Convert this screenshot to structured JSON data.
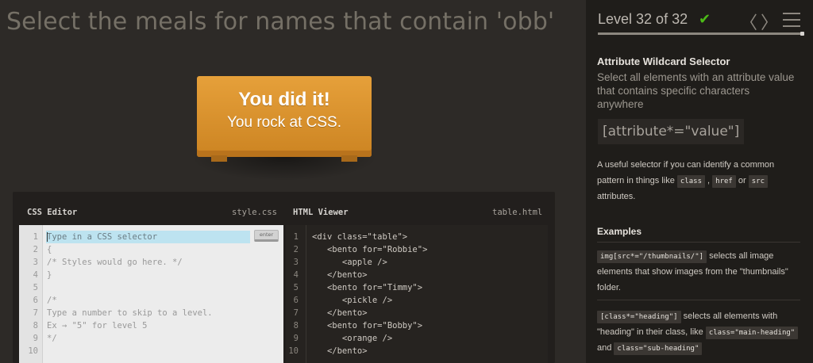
{
  "instruction": "Select the meals for names that contain 'obb'",
  "table": {
    "headline": "You did it!",
    "subline": "You rock at CSS."
  },
  "editor": {
    "css_title": "CSS Editor",
    "css_file": "style.css",
    "html_title": "HTML Viewer",
    "html_file": "table.html",
    "input_placeholder": "Type in a CSS selector",
    "enter_label": "enter",
    "css_lines": [
      {
        "n": "1",
        "text": ""
      },
      {
        "n": "2",
        "text": "{"
      },
      {
        "n": "3",
        "text": "/* Styles would go here. */"
      },
      {
        "n": "4",
        "text": "}"
      },
      {
        "n": "5",
        "text": ""
      },
      {
        "n": "6",
        "text": "/*"
      },
      {
        "n": "7",
        "text": "Type a number to skip to a level."
      },
      {
        "n": "8",
        "text": "Ex → \"5\" for level 5"
      },
      {
        "n": "9",
        "text": "*/"
      },
      {
        "n": "10",
        "text": ""
      }
    ],
    "html_lines": [
      {
        "n": "1",
        "text": "<div class=\"table\">"
      },
      {
        "n": "2",
        "text": "   <bento for=\"Robbie\">"
      },
      {
        "n": "3",
        "text": "      <apple />"
      },
      {
        "n": "4",
        "text": "   </bento>"
      },
      {
        "n": "5",
        "text": "   <bento for=\"Timmy\">"
      },
      {
        "n": "6",
        "text": "      <pickle />"
      },
      {
        "n": "7",
        "text": "   </bento>"
      },
      {
        "n": "8",
        "text": "   <bento for=\"Bobby\">"
      },
      {
        "n": "9",
        "text": "      <orange />"
      },
      {
        "n": "10",
        "text": "   </bento>"
      }
    ]
  },
  "sidebar": {
    "level_text": "Level 32 of 32",
    "check_glyph": "✔",
    "prev_glyph": "〈",
    "next_glyph": "〉",
    "progress_fraction": 1.0,
    "selector_name": "Attribute Wildcard Selector",
    "selector_title": "Select all elements with an attribute value that contains specific characters anywhere",
    "syntax": "[attribute*=\"value\"]",
    "hint_pre": "A useful selector if you can identify a common pattern in things like ",
    "hint_tag1": "class",
    "hint_mid1": " , ",
    "hint_tag2": "href",
    "hint_mid2": " or ",
    "hint_tag3": "src",
    "hint_post": " attributes.",
    "examples_heading": "Examples",
    "example1_code": "img[src*=\"/thumbnails/\"]",
    "example1_text": " selects all image elements that show images from the \"thumbnails\" folder.",
    "example2_code": "[class*=\"heading\"]",
    "example2_text1": " selects all elements with \"heading\" in their class, like ",
    "example2_code2": "class=\"main-heading\"",
    "example2_text2": " and ",
    "example2_code3": "class=\"sub-heading\""
  },
  "colors": {
    "background": "#2d2a27",
    "sidebar": "#1f1d1a",
    "table": "#d9922e",
    "success": "#4cbb17",
    "input_highlight": "#bde3f0"
  }
}
